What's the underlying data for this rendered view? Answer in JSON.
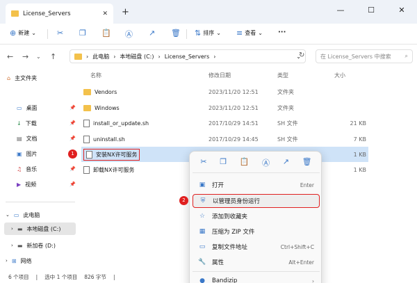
{
  "window": {
    "tab_title": "License_Servers",
    "new_tab": "+",
    "controls": {
      "min": "—",
      "max": "☐",
      "close": "✕"
    }
  },
  "toolbar": {
    "new_label": "新建",
    "sort_label": "排序",
    "view_label": "查看",
    "more_label": "···"
  },
  "address": {
    "crumbs": [
      "此电脑",
      "本地磁盘 (C:)",
      "License_Servers"
    ],
    "search_placeholder": "在 License_Servers 中搜索"
  },
  "sidebar": {
    "home": "主文件夹",
    "quick": [
      {
        "label": "桌面",
        "icon": "desktop-icon"
      },
      {
        "label": "下载",
        "icon": "download-icon"
      },
      {
        "label": "文档",
        "icon": "document-icon"
      },
      {
        "label": "图片",
        "icon": "picture-icon"
      },
      {
        "label": "音乐",
        "icon": "music-icon"
      },
      {
        "label": "视频",
        "icon": "video-icon"
      }
    ],
    "this_pc": "此电脑",
    "drive_c": "本地磁盘 (C:)",
    "drive_d": "新加卷 (D:)",
    "network": "网络"
  },
  "columns": {
    "name": "名称",
    "date": "修改日期",
    "type": "类型",
    "size": "大小"
  },
  "files": [
    {
      "name": "Vendors",
      "date": "2023/11/20 12:51",
      "type": "文件夹",
      "size": "",
      "kind": "folder"
    },
    {
      "name": "Windows",
      "date": "2023/11/20 12:51",
      "type": "文件夹",
      "size": "",
      "kind": "folder"
    },
    {
      "name": "install_or_update.sh",
      "date": "2017/10/29 14:51",
      "type": "SH 文件",
      "size": "21 KB",
      "kind": "file"
    },
    {
      "name": "uninstall.sh",
      "date": "2017/10/29 14:45",
      "type": "SH 文件",
      "size": "7 KB",
      "kind": "file"
    },
    {
      "name": "安装NX许可服务",
      "date": "",
      "type": "",
      "size": "1 KB",
      "kind": "file"
    },
    {
      "name": "卸载NX许可服务",
      "date": "",
      "type": "",
      "size": "1 KB",
      "kind": "file"
    }
  ],
  "badges": {
    "one": "1",
    "two": "2"
  },
  "menu": {
    "items": [
      {
        "label": "打开",
        "shortcut": "Enter",
        "icon": "open-icon"
      },
      {
        "label": "以管理员身份运行",
        "shortcut": "",
        "icon": "admin-shield-icon"
      },
      {
        "label": "添加到收藏夹",
        "shortcut": "",
        "icon": "star-icon"
      },
      {
        "label": "压缩为 ZIP 文件",
        "shortcut": "",
        "icon": "zip-icon"
      },
      {
        "label": "复制文件地址",
        "shortcut": "Ctrl+Shift+C",
        "icon": "copy-path-icon"
      },
      {
        "label": "属性",
        "shortcut": "Alt+Enter",
        "icon": "properties-icon"
      },
      {
        "label": "Bandizip",
        "shortcut": "",
        "icon": "bandizip-icon"
      }
    ]
  },
  "status": {
    "count": "6 个项目",
    "selected": "选中 1 个项目",
    "size": "826 字节"
  }
}
